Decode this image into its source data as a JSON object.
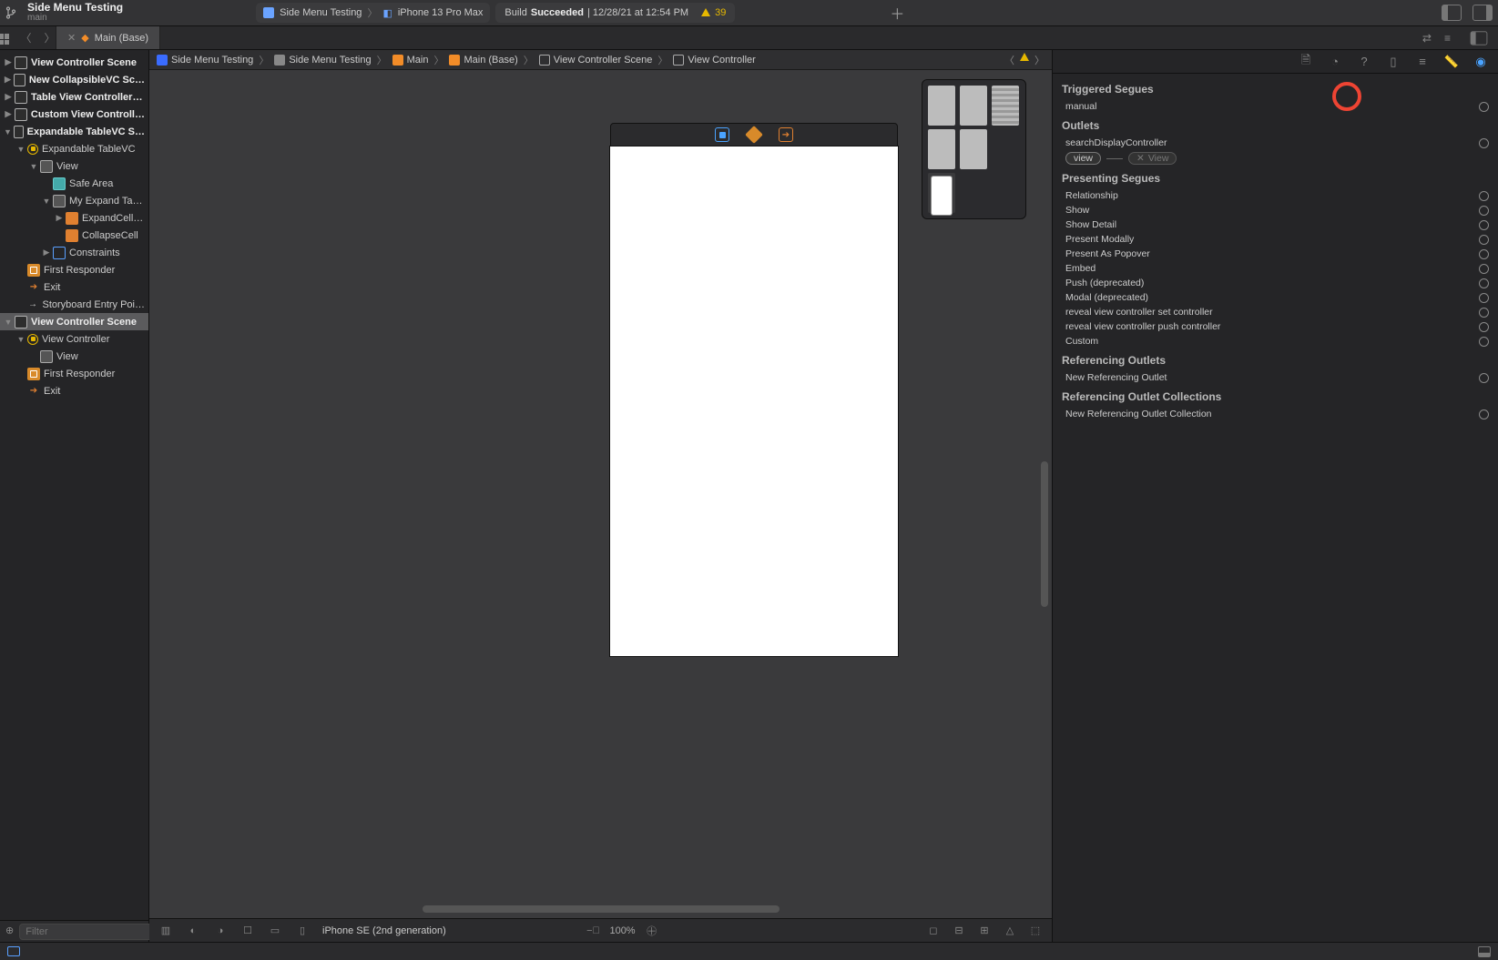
{
  "toolbar": {
    "project_title": "Side Menu Testing",
    "branch": "main",
    "scheme_target": "Side Menu Testing",
    "scheme_device": "iPhone 13 Pro Max",
    "build_prefix": "Build ",
    "build_status": "Succeeded",
    "build_time": " | 12/28/21 at 12:54 PM",
    "warning_count": "39"
  },
  "tab": {
    "label": "Main (Base)"
  },
  "jumpbar": {
    "items": [
      "Side Menu Testing",
      "Side Menu Testing",
      "Main",
      "Main (Base)",
      "View Controller Scene",
      "View Controller"
    ]
  },
  "outline": [
    {
      "d": "closed",
      "lvl": 0,
      "bold": true,
      "icon": "scene",
      "label": "View Controller Scene"
    },
    {
      "d": "closed",
      "lvl": 0,
      "bold": true,
      "icon": "scene",
      "label": "New CollapsibleVC Sc…"
    },
    {
      "d": "closed",
      "lvl": 0,
      "bold": true,
      "icon": "scene",
      "label": "Table View Controller…"
    },
    {
      "d": "closed",
      "lvl": 0,
      "bold": true,
      "icon": "scene",
      "label": "Custom View Controll…"
    },
    {
      "d": "open",
      "lvl": 0,
      "bold": true,
      "icon": "scene",
      "label": "Expandable TableVC S…"
    },
    {
      "d": "open",
      "lvl": 1,
      "icon": "vcring",
      "label": "Expandable TableVC"
    },
    {
      "d": "open",
      "lvl": 2,
      "icon": "view",
      "label": "View"
    },
    {
      "d": "none",
      "lvl": 3,
      "icon": "safe",
      "label": "Safe Area"
    },
    {
      "d": "open",
      "lvl": 3,
      "icon": "view",
      "label": "My Expand Ta…"
    },
    {
      "d": "closed",
      "lvl": 4,
      "icon": "cell",
      "label": "ExpandCell…"
    },
    {
      "d": "none",
      "lvl": 4,
      "icon": "cell",
      "label": "CollapseCell"
    },
    {
      "d": "closed",
      "lvl": 3,
      "icon": "constraints",
      "label": "Constraints"
    },
    {
      "d": "none",
      "lvl": 1,
      "icon": "responder",
      "label": "First Responder"
    },
    {
      "d": "none",
      "lvl": 1,
      "icon": "exit",
      "label": "Exit"
    },
    {
      "d": "none",
      "lvl": 1,
      "icon": "entry",
      "label": "Storyboard Entry Poi…"
    },
    {
      "d": "open",
      "lvl": 0,
      "bold": true,
      "sel": true,
      "icon": "scene",
      "label": "View Controller Scene"
    },
    {
      "d": "open",
      "lvl": 1,
      "icon": "vcring",
      "label": "View Controller"
    },
    {
      "d": "none",
      "lvl": 2,
      "icon": "view",
      "label": "View"
    },
    {
      "d": "none",
      "lvl": 1,
      "icon": "responder",
      "label": "First Responder"
    },
    {
      "d": "none",
      "lvl": 1,
      "icon": "exit",
      "label": "Exit"
    }
  ],
  "filter_placeholder": "Filter",
  "editor_footer": {
    "device": "iPhone SE (2nd generation)",
    "zoom": "100%"
  },
  "inspector": {
    "triggered_h": "Triggered Segues",
    "triggered": [
      {
        "label": "manual"
      }
    ],
    "outlets_h": "Outlets",
    "outlets": [
      {
        "label": "searchDisplayController"
      },
      {
        "label_pill": "view",
        "dest": "View"
      }
    ],
    "presenting_h": "Presenting Segues",
    "presenting": [
      {
        "label": "Relationship"
      },
      {
        "label": "Show"
      },
      {
        "label": "Show Detail"
      },
      {
        "label": "Present Modally"
      },
      {
        "label": "Present As Popover"
      },
      {
        "label": "Embed"
      },
      {
        "label": "Push (deprecated)"
      },
      {
        "label": "Modal (deprecated)"
      },
      {
        "label": "reveal view controller set controller"
      },
      {
        "label": "reveal view controller push controller"
      },
      {
        "label": "Custom"
      }
    ],
    "ref_outlets_h": "Referencing Outlets",
    "ref_outlets": [
      {
        "label": "New Referencing Outlet"
      }
    ],
    "ref_coll_h": "Referencing Outlet Collections",
    "ref_coll": [
      {
        "label": "New Referencing Outlet Collection"
      }
    ]
  }
}
